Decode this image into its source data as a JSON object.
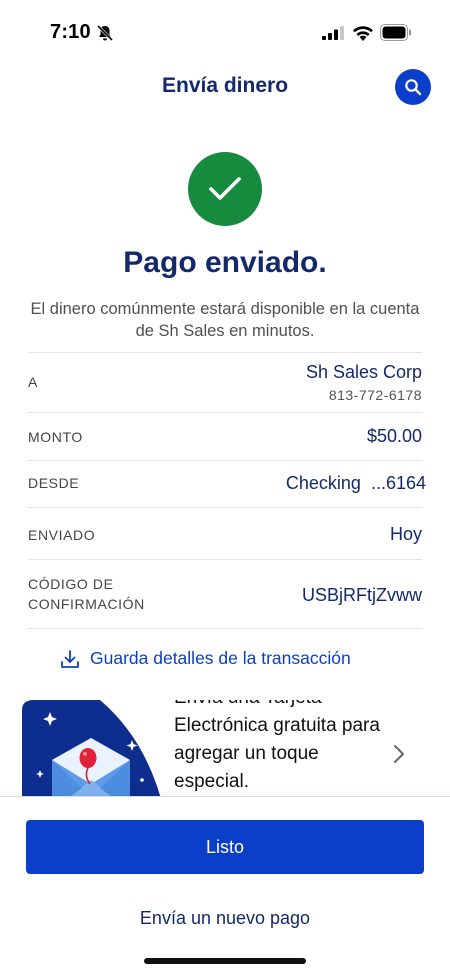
{
  "status_bar": {
    "time": "7:10"
  },
  "header": {
    "title": "Envía dinero"
  },
  "success": {
    "title": "Pago enviado.",
    "message": "El dinero comúnmente estará disponible en la cuenta de Sh Sales en minutos."
  },
  "details": {
    "to": {
      "label": "A",
      "name": "Sh Sales Corp",
      "phone": "813-772-6178"
    },
    "amount": {
      "label": "MONTO",
      "value": "$50.00"
    },
    "from": {
      "label": "DESDE",
      "value": "Checking  ...6164"
    },
    "sent": {
      "label": "ENVIADO",
      "value": "Hoy"
    },
    "confirmation": {
      "label_line1": "CÓDIGO DE",
      "label_line2": "CONFIRMACIÓN",
      "value": "USBjRFtjZvww"
    }
  },
  "save_link": {
    "label": "Guarda detalles de la transacción"
  },
  "promo": {
    "text": "Envía una Tarjeta Electrónica gratuita para agregar un toque especial."
  },
  "actions": {
    "done_label": "Listo",
    "new_payment_label": "Envía un nuevo pago"
  },
  "colors": {
    "navy": "#14296b",
    "accent_blue": "#0b3ec9",
    "success_green": "#168a3d"
  },
  "icons": [
    "bell-slash-icon",
    "signal-icon",
    "wifi-icon",
    "battery-icon",
    "search-icon",
    "checkmark-icon",
    "download-icon",
    "envelope-balloon-icon",
    "chevron-right-icon"
  ]
}
